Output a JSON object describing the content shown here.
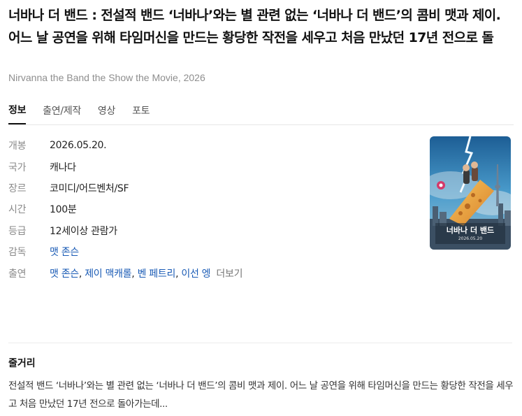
{
  "header": {
    "title": "너바나 더 밴드 : 전설적 밴드 ‘너바나’와는 별 관련 없는 ‘너바나 더 밴드’의 콤비 맷과 제이. 어느 날 공연을 위해 타임머신을 만드는 황당한 작전을 세우고 처음 만났던 17년 전으로 돌",
    "subtitle": "Nirvanna the Band the Show the Movie, 2026"
  },
  "tabs": [
    {
      "label": "정보",
      "active": true
    },
    {
      "label": "출연/제작",
      "active": false
    },
    {
      "label": "영상",
      "active": false
    },
    {
      "label": "포토",
      "active": false
    }
  ],
  "info": {
    "release": {
      "label": "개봉",
      "value": "2026.05.20."
    },
    "country": {
      "label": "국가",
      "value": "캐나다"
    },
    "genre": {
      "label": "장르",
      "value": "코미디/어드벤처/SF"
    },
    "runtime": {
      "label": "시간",
      "value": "100분"
    },
    "rating": {
      "label": "등급",
      "value": "12세이상 관람가"
    },
    "director": {
      "label": "감독",
      "value": "맷 존슨"
    },
    "cast": {
      "label": "출연",
      "names": [
        "맷 존슨",
        "제이 맥캐롤",
        "벤 페트리",
        "이선 엥"
      ],
      "more": "더보기"
    }
  },
  "poster": {
    "title": "너바나 더 밴드",
    "date": "2026.05.20",
    "colors": {
      "sky": "#2f7fb5",
      "city": "#3b4f63",
      "cheese": "#e8a23a",
      "lightning": "#dff3ff"
    }
  },
  "synopsis": {
    "heading": "줄거리",
    "text": "전설적 밴드 ‘너바나’와는 별 관련 없는 ‘너바나 더 밴드’의 콤비 맷과 제이. 어느 날 공연을 위해 타임머신을 만드는 황당한 작전을 세우고 처음 만났던 17년 전으로 돌아가는데..."
  },
  "theme": {
    "link": "#1a5bb5",
    "muted": "#8a8a8a"
  }
}
